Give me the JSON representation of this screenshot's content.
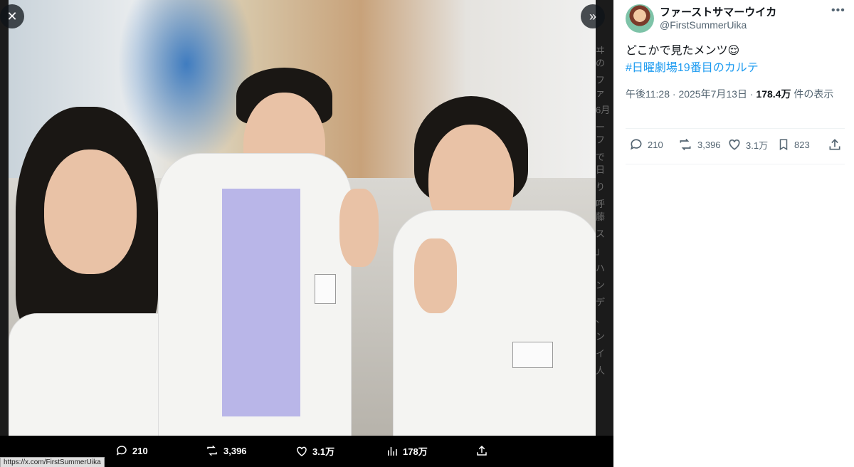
{
  "media": {
    "close_icon": "close-icon",
    "expand_icon": "chevron-double-right-icon",
    "behind_text": [
      "ヰの",
      "ファ",
      "6月",
      "ーフ",
      "で日",
      "り",
      "呼藤",
      "ス",
      "",
      "」",
      "ハ",
      "",
      "ン",
      "デ",
      "",
      "",
      "、",
      "",
      "",
      "",
      "ン",
      "イ",
      "人"
    ],
    "actions": {
      "replies": "210",
      "retweets": "3,396",
      "likes": "3.1万",
      "views": "178万"
    },
    "url_tooltip": "https://x.com/FirstSummerUika"
  },
  "tweet": {
    "display_name": "ファーストサマーウイカ",
    "handle": "@FirstSummerUika",
    "text": "どこかで見たメンツ😌",
    "hashtag": "#日曜劇場19番目のカルテ",
    "time": "午後11:28",
    "date": "2025年7月13日",
    "views_count": "178.4万",
    "views_label": "件の表示",
    "separator": "·",
    "actions": {
      "replies": "210",
      "retweets": "3,396",
      "likes": "3.1万",
      "bookmarks": "823"
    }
  },
  "colors": {
    "accent": "#1d9bf0",
    "text": "#0f1419",
    "muted": "#536471"
  }
}
